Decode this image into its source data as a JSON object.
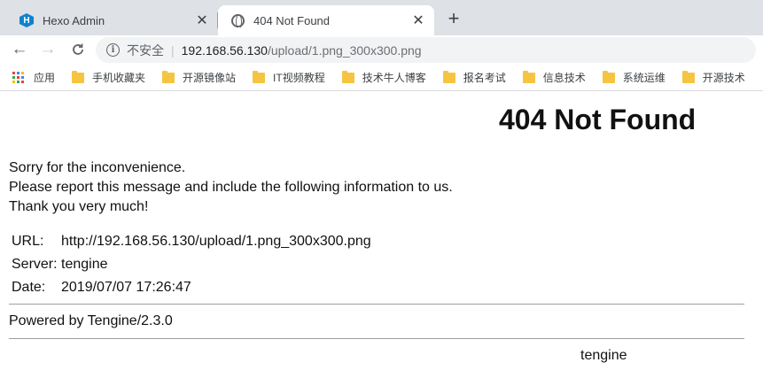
{
  "browser": {
    "tabs": [
      {
        "title": "Hexo Admin",
        "icon": "hexo-icon",
        "active": false,
        "favicon_letter": "H"
      },
      {
        "title": "404 Not Found",
        "icon": "globe-icon",
        "active": true
      }
    ],
    "tab_close_glyph": "✕",
    "new_tab_glyph": "+",
    "toolbar": {
      "back_glyph": "←",
      "forward_glyph": "→",
      "reload_glyph": "C",
      "info_glyph": "i",
      "security_label": "不安全",
      "separator": "|",
      "url_host": "192.168.56.130",
      "url_path": "/upload/1.png_300x300.png"
    },
    "bookmarks": [
      {
        "label": "应用",
        "icon": "apps-icon"
      },
      {
        "label": "手机收藏夹",
        "icon": "folder-icon"
      },
      {
        "label": "开源镜像站",
        "icon": "folder-icon"
      },
      {
        "label": "IT视频教程",
        "icon": "folder-icon"
      },
      {
        "label": "技术牛人博客",
        "icon": "folder-icon"
      },
      {
        "label": "报名考试",
        "icon": "folder-icon"
      },
      {
        "label": "信息技术",
        "icon": "folder-icon"
      },
      {
        "label": "系统运维",
        "icon": "folder-icon"
      },
      {
        "label": "开源技术",
        "icon": "folder-icon"
      }
    ]
  },
  "colors": {
    "tab_strip": "#dee1e6",
    "omnibox": "#f1f3f4",
    "folder": "#f5c542",
    "hexo": "#0e83cd"
  },
  "page": {
    "title": "404 Not Found",
    "message_lines": [
      "Sorry for the inconvenience.",
      "Please report this message and include the following information to us.",
      "Thank you very much!"
    ],
    "info": [
      {
        "label": "URL:",
        "value": "http://192.168.56.130/upload/1.png_300x300.png"
      },
      {
        "label": "Server:",
        "value": "tengine"
      },
      {
        "label": "Date:",
        "value": "2019/07/07 17:26:47"
      }
    ],
    "powered_by": "Powered by Tengine/2.3.0",
    "footer_host": "tengine"
  }
}
